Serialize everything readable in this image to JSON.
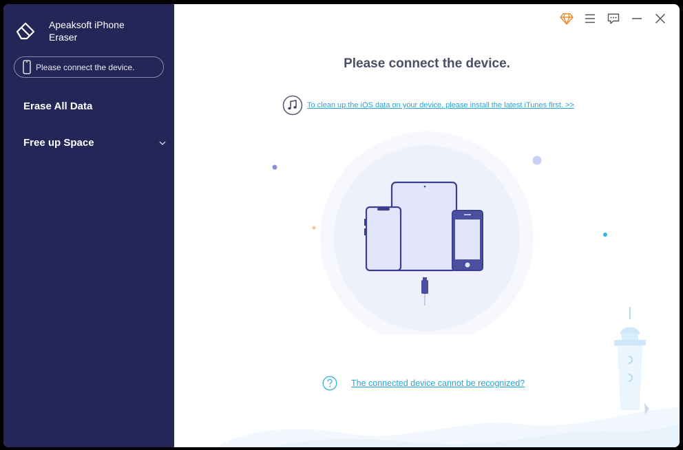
{
  "app": {
    "title_line1": "Apeaksoft iPhone",
    "title_line2": "Eraser"
  },
  "sidebar": {
    "device_status": "Please connect the device.",
    "items": [
      {
        "label": "Erase All Data"
      },
      {
        "label": "Free up Space"
      }
    ]
  },
  "main": {
    "heading": "Please connect the device.",
    "itunes_link": "To clean up the iOS data on your device, please install the latest iTunes first. >>",
    "help_link": "The connected device cannot be recognized?"
  },
  "colors": {
    "sidebar_bg": "#232657",
    "accent_link": "#2aa3d6",
    "device_stroke": "#3c3f8f",
    "device_fill": "#e3e6fb",
    "premium_icon": "#f08a24"
  },
  "icons": {
    "logo": "eraser-icon",
    "premium": "diamond-icon",
    "menu": "hamburger-icon",
    "feedback": "chat-icon",
    "minimize": "minimize-icon",
    "close": "close-icon",
    "music": "music-note-icon",
    "help": "question-icon"
  }
}
